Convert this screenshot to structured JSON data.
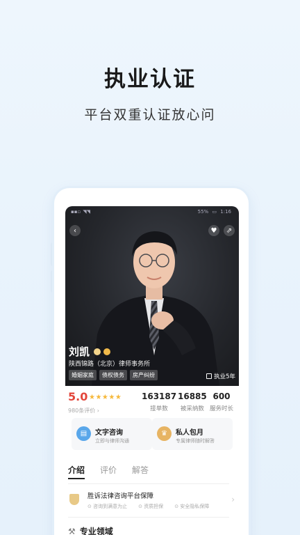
{
  "promo": {
    "title": "执业认证",
    "subtitle": "平台双重认证放心问"
  },
  "status_bar": {
    "left": "",
    "battery": "55%",
    "time": "1:16"
  },
  "lawyer": {
    "name": "刘凯",
    "firm": "陕西锦路（北京）律师事务所",
    "tags": [
      "婚姻家庭",
      "债权债务",
      "房产纠纷"
    ],
    "years": "执业5年"
  },
  "stats": {
    "score": "5.0",
    "stars": 5,
    "review_count": "980条评价 ›",
    "orders": {
      "value": "163187",
      "label": "接单数"
    },
    "adopted": {
      "value": "16885",
      "label": "被采纳数"
    },
    "duration": {
      "value": "600",
      "label": "服务时长"
    }
  },
  "services": [
    {
      "title": "文字咨询",
      "desc": "立即与律师沟通",
      "icon": "chat-icon"
    },
    {
      "title": "私人包月",
      "desc": "专属律师随时解答",
      "icon": "crown-icon"
    }
  ],
  "tabs": [
    "介绍",
    "评价",
    "解答"
  ],
  "guarantee": {
    "title": "胜诉法律咨询平台保障",
    "items": [
      "咨询到满意为止",
      "资质担保",
      "安全隐私保障"
    ]
  },
  "section": {
    "title": "专业领域"
  },
  "colors": {
    "score": "#e3463b",
    "stars": "#f6b83a",
    "chat_icon_bg": "#5aa7ea",
    "crown_icon_bg": "#e7b463"
  }
}
